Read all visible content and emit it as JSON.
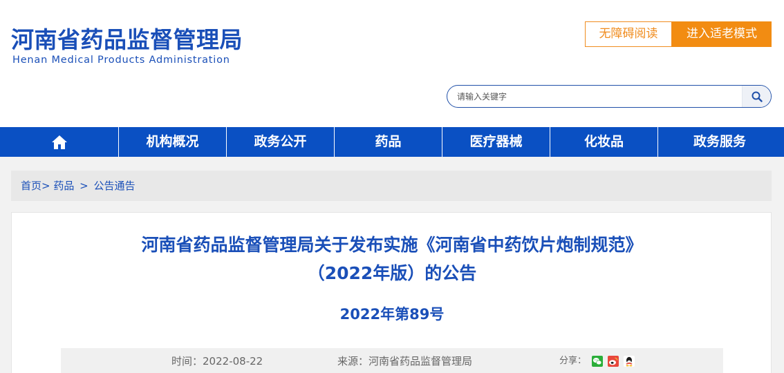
{
  "header": {
    "logo_cn": "河南省药品监督管理局",
    "logo_en": "Henan Medical Products Administration",
    "accessibility_label": "无障碍阅读",
    "elder_mode_label": "进入适老模式",
    "search_placeholder": "请输入关键字"
  },
  "nav": {
    "home_icon": "home-icon",
    "items": [
      "机构概况",
      "政务公开",
      "药品",
      "医疗器械",
      "化妆品",
      "政务服务"
    ]
  },
  "breadcrumb": {
    "items": [
      "首页",
      "药品",
      "公告通告"
    ],
    "separators": [
      ">",
      ">"
    ]
  },
  "article": {
    "title_line1": "河南省药品监督管理局关于发布实施《河南省中药饮片炮制规范》",
    "title_line2": "（2022年版）的公告",
    "doc_number": "2022年第89号",
    "time_label": "时间：",
    "time_value": "2022-08-22",
    "source_label": "来源：",
    "source_value": "河南省药品监督管理局",
    "share_label": "分享：",
    "share_icons": [
      "wechat-icon",
      "weibo-icon",
      "qq-icon"
    ]
  },
  "colors": {
    "brand_blue": "#0a50c3",
    "title_blue": "#1a4fb8",
    "accent_orange": "#f28c12"
  }
}
